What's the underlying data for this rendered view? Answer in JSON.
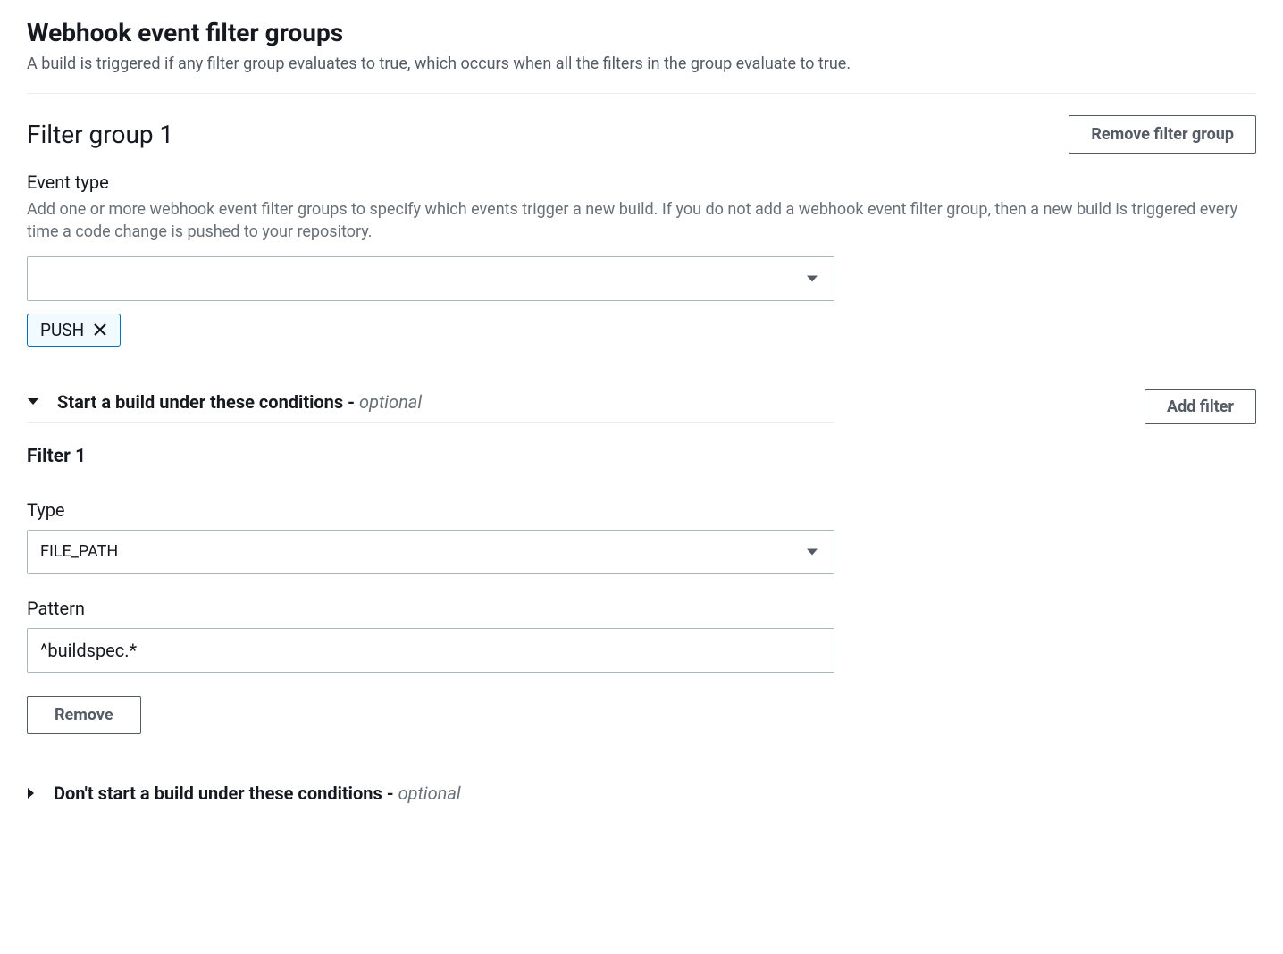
{
  "header": {
    "title": "Webhook event filter groups",
    "subtitle": "A build is triggered if any filter group evaluates to true, which occurs when all the filters in the group evaluate to true."
  },
  "group": {
    "title": "Filter group 1",
    "remove_label": "Remove filter group"
  },
  "event_type": {
    "label": "Event type",
    "description": "Add one or more webhook event filter groups to specify which events trigger a new build. If you do not add a webhook event filter group, then a new build is triggered every time a code change is pushed to your repository.",
    "selected_value": "",
    "token": "PUSH"
  },
  "expander_start": {
    "title": "Start a build under these conditions",
    "optional": "optional",
    "add_filter_label": "Add filter"
  },
  "filter1": {
    "heading": "Filter 1",
    "type_label": "Type",
    "type_value": "FILE_PATH",
    "pattern_label": "Pattern",
    "pattern_value": "^buildspec.*",
    "remove_label": "Remove"
  },
  "expander_dont": {
    "title": "Don't start a build under these conditions",
    "optional": "optional"
  }
}
